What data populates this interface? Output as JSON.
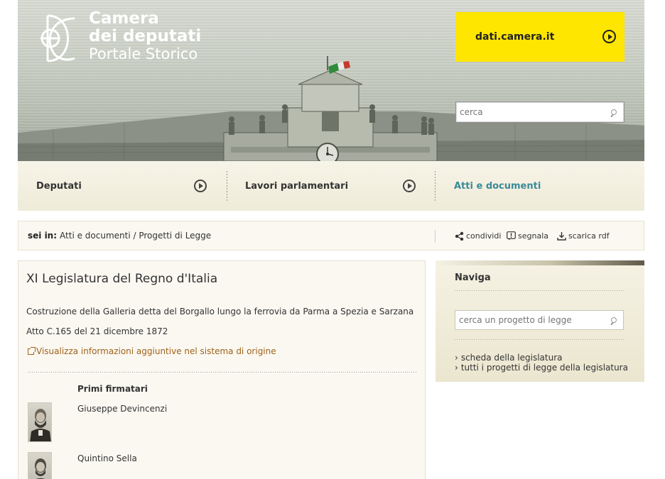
{
  "header": {
    "logo_line1": "Camera",
    "logo_line2": "dei deputati",
    "logo_line3": "Portale Storico",
    "dati_label": "dati.camera.it",
    "search_placeholder": "cerca",
    "accent_color": "#ffe600"
  },
  "nav": {
    "items": [
      {
        "label": "Deputati",
        "active": false
      },
      {
        "label": "Lavori parlamentari",
        "active": false
      },
      {
        "label": "Atti e documenti",
        "active": true
      }
    ],
    "active_color": "#3a8a98"
  },
  "breadcrumb": {
    "prefix": "sei in:",
    "path": "Atti e documenti / Progetti di Legge",
    "tools": {
      "share": "condividi",
      "report": "segnala",
      "download": "scarica rdf"
    }
  },
  "main": {
    "title": "XI Legislatura del Regno d'Italia",
    "description": "Costruzione della Galleria detta del Borgallo lungo la ferrovia da Parma a Spezia e Sarzana",
    "act": "Atto C.165 del 21 dicembre 1872",
    "external_link": "Visualizza informazioni aggiuntive nel sistema di origine",
    "signers_heading": "Primi firmatari",
    "signers": [
      {
        "name": "Giuseppe Devincenzi"
      },
      {
        "name": "Quintino Sella"
      }
    ]
  },
  "sidebar": {
    "title": "Naviga",
    "search_placeholder": "cerca un progetto di legge",
    "links": [
      "scheda della legislatura",
      "tutti i progetti di legge della legislatura"
    ]
  }
}
